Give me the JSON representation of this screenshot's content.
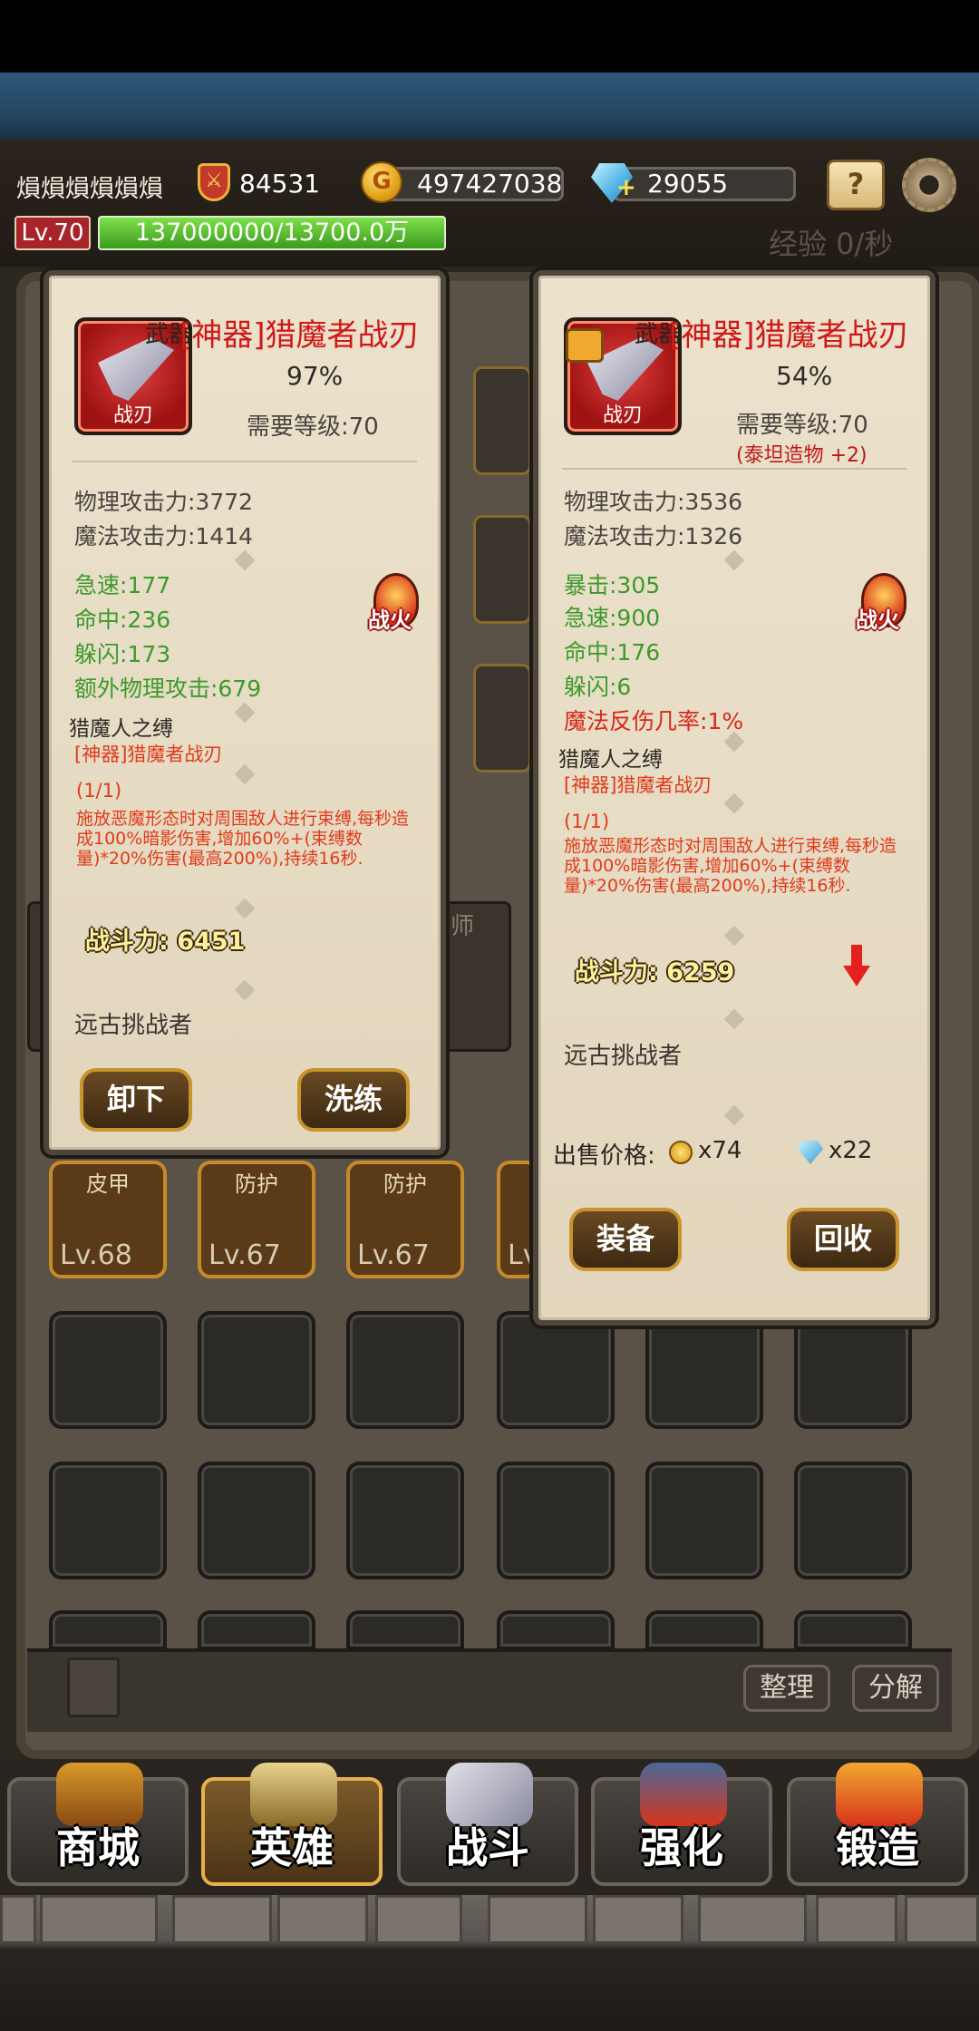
{
  "header": {
    "player_name": "熉熉熉熉熉熉",
    "power": "84531",
    "gold": "497427038",
    "gems": "29055",
    "level": "Lv.70",
    "exp_bar": "137000000/13700.0万",
    "exp_rate": "经验 0/秒"
  },
  "equipped_item": {
    "slot": "武器",
    "name": "[神器]猎魔者战刃",
    "icon_label": "战刃",
    "quality_pct": "97%",
    "required_level": "需要等级:70",
    "stats": [
      "物理攻击力:3772",
      "魔法攻击力:1414"
    ],
    "bonus_stats": [
      "急速:177",
      "命中:236",
      "躲闪:173",
      "额外物理攻击:679"
    ],
    "badge": "战火",
    "set_name": "猎魔人之缚",
    "set_item": "[神器]猎魔者战刃",
    "set_count": "(1/1)",
    "set_desc": "施放恶魔形态时对周围敌人进行束缚,每秒造成100%暗影伤害,增加60%+(束缚数量)*20%伤害(最高200%),持续16秒.",
    "combat_power": "战斗力: 6451",
    "origin": "远古挑战者",
    "btn_left": "卸下",
    "btn_right": "洗练"
  },
  "compare_item": {
    "slot": "武器",
    "name": "[神器]猎魔者战刃",
    "icon_label": "战刃",
    "quality_pct": "54%",
    "required_level": "需要等级:70",
    "refine": "(泰坦造物 +2)",
    "stats": [
      "物理攻击力:3536",
      "魔法攻击力:1326"
    ],
    "bonus_stats": [
      "暴击:305",
      "急速:900",
      "命中:176",
      "躲闪:6"
    ],
    "special_stat": "魔法反伤几率:1%",
    "badge": "战火",
    "set_name": "猎魔人之缚",
    "set_item": "[神器]猎魔者战刃",
    "set_count": "(1/1)",
    "set_desc": "施放恶魔形态时对周围敌人进行束缚,每秒造成100%暗影伤害,增加60%+(束缚数量)*20%伤害(最高200%),持续16秒.",
    "combat_power": "战斗力: 6259",
    "origin": "远古挑战者",
    "sell_label": "出售价格:",
    "sell_gold": "x74",
    "sell_gems": "x22",
    "btn_left": "装备",
    "btn_right": "回收"
  },
  "inventory": {
    "equip_items": [
      {
        "type": "皮甲",
        "level": "Lv.68"
      },
      {
        "type": "防护",
        "level": "Lv.67"
      },
      {
        "type": "防护",
        "level": "Lv.67"
      },
      {
        "type": "",
        "level": "Lv"
      }
    ],
    "hero_tag": "师",
    "sort_btn": "整理",
    "decompose_btn": "分解"
  },
  "nav": {
    "items": [
      {
        "label": "商城",
        "icon": "treasure-chest-icon"
      },
      {
        "label": "英雄",
        "icon": "viking-helmet-icon"
      },
      {
        "label": "战斗",
        "icon": "crossed-swords-icon"
      },
      {
        "label": "强化",
        "icon": "anvil-hammer-icon"
      },
      {
        "label": "锻造",
        "icon": "forge-sword-icon"
      }
    ],
    "active": "英雄"
  },
  "colors": {
    "title_red": "#d01818",
    "stat_green": "#3d9a2c",
    "banner_blue": "#244764",
    "button_gold": "#c8942e"
  }
}
